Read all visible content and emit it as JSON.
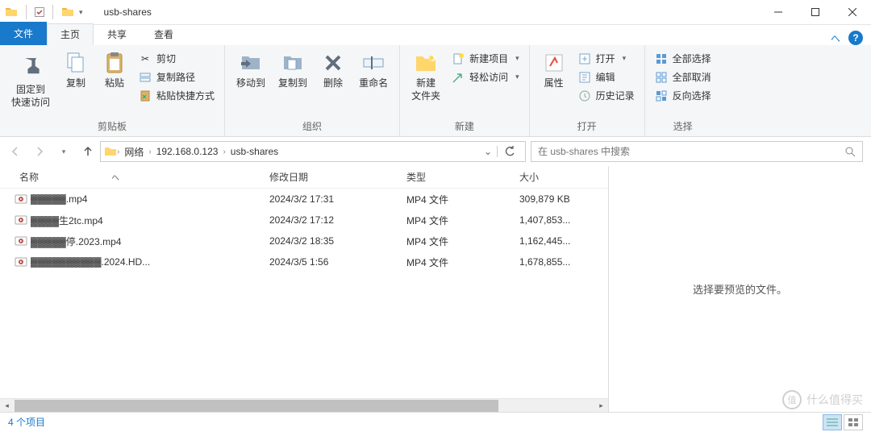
{
  "title": "usb-shares",
  "tabs": {
    "file": "文件",
    "home": "主页",
    "share": "共享",
    "view": "查看"
  },
  "ribbon": {
    "clipboard": {
      "label": "剪贴板",
      "pin": "固定到\n快速访问",
      "copy": "复制",
      "paste": "粘贴",
      "cut": "剪切",
      "copypath": "复制路径",
      "pasteshortcut": "粘贴快捷方式"
    },
    "organize": {
      "label": "组织",
      "moveto": "移动到",
      "copyto": "复制到",
      "delete": "删除",
      "rename": "重命名"
    },
    "new": {
      "label": "新建",
      "newfolder": "新建\n文件夹",
      "newitem": "新建项目",
      "easyaccess": "轻松访问"
    },
    "open": {
      "label": "打开",
      "properties": "属性",
      "openlbl": "打开",
      "edit": "编辑",
      "history": "历史记录"
    },
    "select": {
      "label": "选择",
      "selectall": "全部选择",
      "selectnone": "全部取消",
      "invert": "反向选择"
    }
  },
  "breadcrumb": [
    "网络",
    "192.168.0.123",
    "usb-shares"
  ],
  "search_placeholder": "在 usb-shares 中搜索",
  "columns": {
    "name": "名称",
    "date": "修改日期",
    "type": "类型",
    "size": "大小"
  },
  "files": [
    {
      "name": "▓▓▓▓▓.mp4",
      "date": "2024/3/2 17:31",
      "type": "MP4 文件",
      "size": "309,879 KB"
    },
    {
      "name": "▓▓▓▓生2tc.mp4",
      "date": "2024/3/2 17:12",
      "type": "MP4 文件",
      "size": "1,407,853..."
    },
    {
      "name": "▓▓▓▓▓停.2023.mp4",
      "date": "2024/3/2 18:35",
      "type": "MP4 文件",
      "size": "1,162,445..."
    },
    {
      "name": "▓▓▓▓▓▓▓▓▓▓.2024.HD...",
      "date": "2024/3/5 1:56",
      "type": "MP4 文件",
      "size": "1,678,855..."
    }
  ],
  "preview_text": "选择要预览的文件。",
  "status": "4 个项目",
  "watermark": "什么值得买"
}
